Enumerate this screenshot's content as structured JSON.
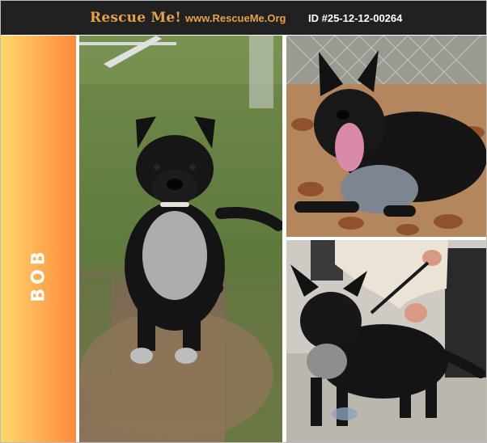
{
  "header": {
    "brand": "Rescue Me!",
    "site": "www.RescueMe.Org",
    "pet_id": "ID #25-12-12-00264"
  },
  "pet": {
    "name": "BOB"
  },
  "photos": [
    {
      "name": "photo-main",
      "subject": "black-and-white dog sitting on grass and dirt"
    },
    {
      "name": "photo-top-right",
      "subject": "black dog lying in autumn leaves with tongue out"
    },
    {
      "name": "photo-bottom-right",
      "subject": "black dog standing indoors on leash"
    }
  ],
  "colors": {
    "header_bg": "#212121",
    "brand": "#e6a04a",
    "id_text": "#ffffff",
    "strip_top": "#ffd86a",
    "strip_bottom": "#ff8a3d",
    "name_text": "#ffffff"
  }
}
